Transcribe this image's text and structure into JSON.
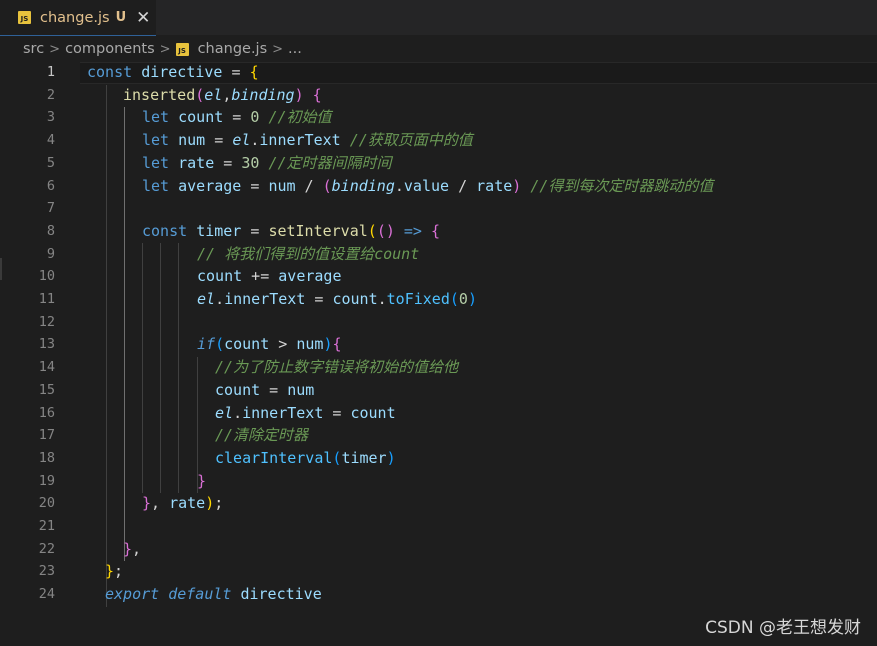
{
  "tab": {
    "icon_label": "JS",
    "file_name": "change.js",
    "status": "U",
    "close_glyph": "✕"
  },
  "breadcrumb": {
    "segments": [
      "src",
      "components",
      "change.js",
      "..."
    ],
    "separator": ">"
  },
  "editor": {
    "current_line": 1,
    "lines": [
      {
        "n": "1"
      },
      {
        "n": "2"
      },
      {
        "n": "3"
      },
      {
        "n": "4"
      },
      {
        "n": "5"
      },
      {
        "n": "6"
      },
      {
        "n": "7"
      },
      {
        "n": "8"
      },
      {
        "n": "9"
      },
      {
        "n": "10"
      },
      {
        "n": "11"
      },
      {
        "n": "12"
      },
      {
        "n": "13"
      },
      {
        "n": "14"
      },
      {
        "n": "15"
      },
      {
        "n": "16"
      },
      {
        "n": "17"
      },
      {
        "n": "18"
      },
      {
        "n": "19"
      },
      {
        "n": "20"
      },
      {
        "n": "21"
      },
      {
        "n": "22"
      },
      {
        "n": "23"
      },
      {
        "n": "24"
      }
    ],
    "tokens": {
      "l1": [
        "const",
        " ",
        "directive",
        " = ",
        "{"
      ],
      "l2": [
        "inserted",
        "(",
        "el",
        ",",
        "binding",
        ")",
        " ",
        "{"
      ],
      "l3": [
        "let",
        " ",
        "count",
        " = ",
        "0",
        " ",
        "//初始值"
      ],
      "l4": [
        "let",
        " ",
        "num",
        " = ",
        "el",
        ".",
        "innerText",
        " ",
        "//获取页面中的值"
      ],
      "l5": [
        "let",
        " ",
        "rate",
        " = ",
        "30",
        " ",
        "//定时器间隔时间"
      ],
      "l6": [
        "let",
        " ",
        "average",
        " = ",
        "num",
        " / ",
        "(",
        "binding",
        ".",
        "value",
        " / ",
        "rate",
        ")",
        " ",
        "//得到每次定时器跳动的值"
      ],
      "l8": [
        "const",
        " ",
        "timer",
        " = ",
        "setInterval",
        "(",
        "()",
        " => ",
        "{"
      ],
      "l9": [
        "// 将我们得到的值设置给count"
      ],
      "l10": [
        "count",
        " += ",
        "average"
      ],
      "l11": [
        "el",
        ".",
        "innerText",
        " = ",
        "count",
        ".",
        "toFixed",
        "(",
        "0",
        ")"
      ],
      "l13": [
        "if",
        "(",
        "count",
        " > ",
        "num",
        ")",
        "{"
      ],
      "l14": [
        "//为了防止数字错误将初始的值给他"
      ],
      "l15": [
        "count",
        " = ",
        "num"
      ],
      "l16": [
        "el",
        ".",
        "innerText",
        " = ",
        "count"
      ],
      "l17": [
        "//清除定时器"
      ],
      "l18": [
        "clearInterval",
        "(",
        "timer",
        ")"
      ],
      "l19": [
        "}"
      ],
      "l20": [
        "}",
        ", ",
        "rate",
        ")",
        ";"
      ],
      "l22": [
        "}",
        ","
      ],
      "l23": [
        "}",
        ";"
      ],
      "l24": [
        "export",
        " ",
        "default",
        " ",
        "directive"
      ]
    }
  },
  "watermark": "CSDN @老王想发财",
  "colors": {
    "keyword": "#569cd6",
    "variable": "#9cdcfe",
    "function": "#dcdcaa",
    "number": "#b5cea8",
    "comment": "#6a9955",
    "control": "#c586c0",
    "modified_file": "#e2c08d"
  }
}
